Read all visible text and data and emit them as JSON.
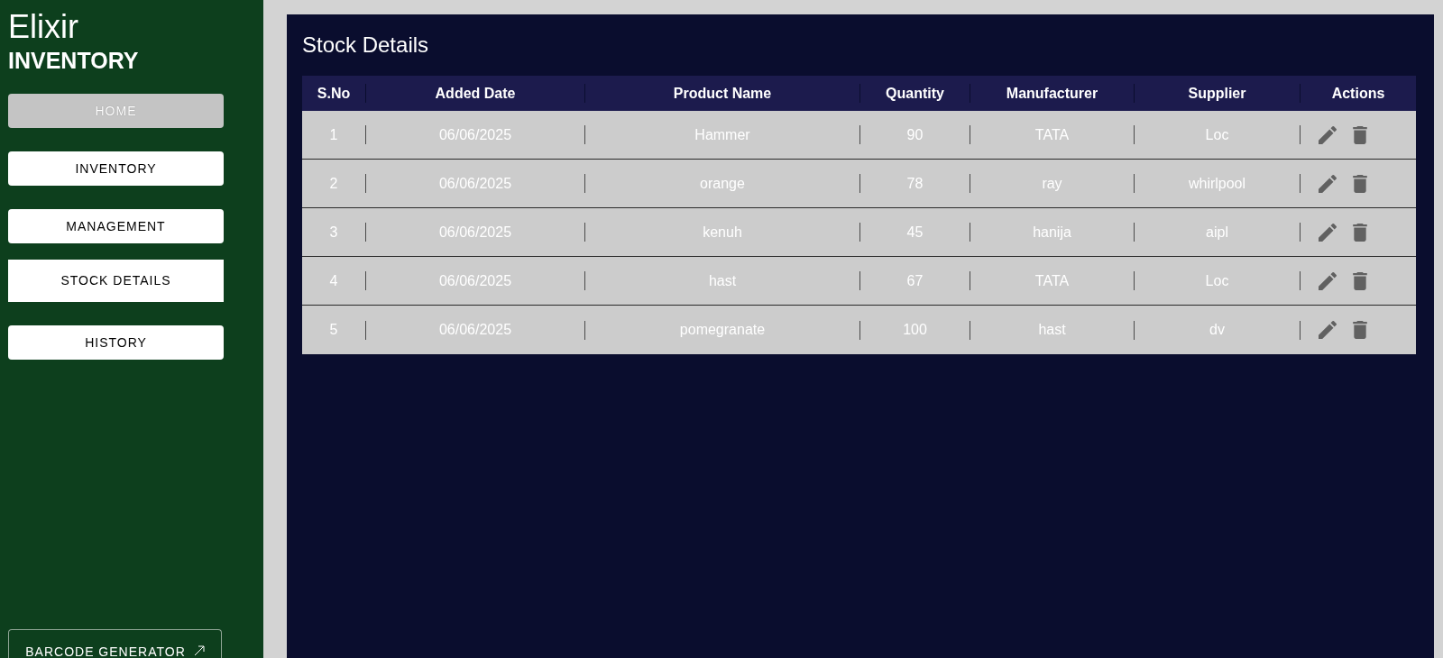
{
  "sidebar": {
    "brand": {
      "title": "Elixir",
      "subtitle": "INVENTORY"
    },
    "nav": [
      {
        "label": "HOME",
        "selected": false,
        "hovered": true
      },
      {
        "label": "INVENTORY",
        "selected": false,
        "hovered": false
      },
      {
        "label": "MANAGEMENT",
        "selected": false,
        "hovered": false
      },
      {
        "label": "STOCK DETAILS",
        "selected": true,
        "hovered": false
      },
      {
        "label": "HISTORY",
        "selected": false,
        "hovered": false
      }
    ],
    "footer_button": {
      "label": "BARCODE GENERATOR"
    }
  },
  "page": {
    "title": "Stock Details"
  },
  "table": {
    "columns": [
      "S.No",
      "Added Date",
      "Product Name",
      "Quantity",
      "Manufacturer",
      "Supplier",
      "Actions"
    ],
    "rows": [
      {
        "cells": [
          "1",
          "06/06/2025",
          "Hammer",
          "90",
          "TATA",
          "Loc"
        ]
      },
      {
        "cells": [
          "2",
          "06/06/2025",
          "orange",
          "78",
          "ray",
          "whirlpool"
        ]
      },
      {
        "cells": [
          "3",
          "06/06/2025",
          "kenuh",
          "45",
          "hanija",
          "aipl"
        ]
      },
      {
        "cells": [
          "4",
          "06/06/2025",
          "hast",
          "67",
          "TATA",
          "Loc"
        ]
      },
      {
        "cells": [
          "5",
          "06/06/2025",
          "pomegranate",
          "100",
          "hast",
          "dv"
        ]
      }
    ]
  }
}
